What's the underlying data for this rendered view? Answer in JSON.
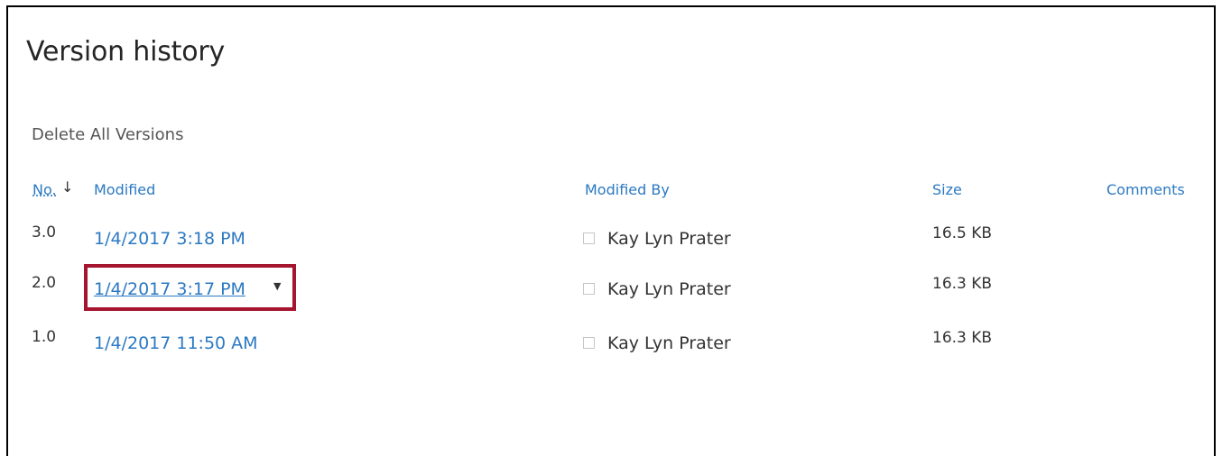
{
  "page": {
    "title": "Version history",
    "delete_all_label": "Delete All Versions"
  },
  "table": {
    "headers": {
      "no": "No.",
      "sort_arrow": "↓",
      "modified": "Modified",
      "modified_by": "Modified By",
      "size": "Size",
      "comments": "Comments"
    },
    "rows": [
      {
        "no": "3.0",
        "modified": "1/4/2017 3:18 PM",
        "modified_by": "Kay Lyn Prater",
        "size": "16.5 KB",
        "comments": ""
      },
      {
        "no": "2.0",
        "modified": "1/4/2017 3:17 PM",
        "modified_by": "Kay Lyn Prater",
        "size": "16.3 KB",
        "comments": "",
        "highlighted": true
      },
      {
        "no": "1.0",
        "modified": "1/4/2017 11:50 AM",
        "modified_by": "Kay Lyn Prater",
        "size": "16.3 KB",
        "comments": ""
      }
    ]
  },
  "colors": {
    "link": "#2b79c2",
    "text": "#333333",
    "highlight_border": "#a5152e"
  },
  "icons": {
    "sort": "sort-descending-arrow-icon",
    "dropdown": "chevron-down-icon",
    "user_checkbox": "checkbox-icon"
  }
}
